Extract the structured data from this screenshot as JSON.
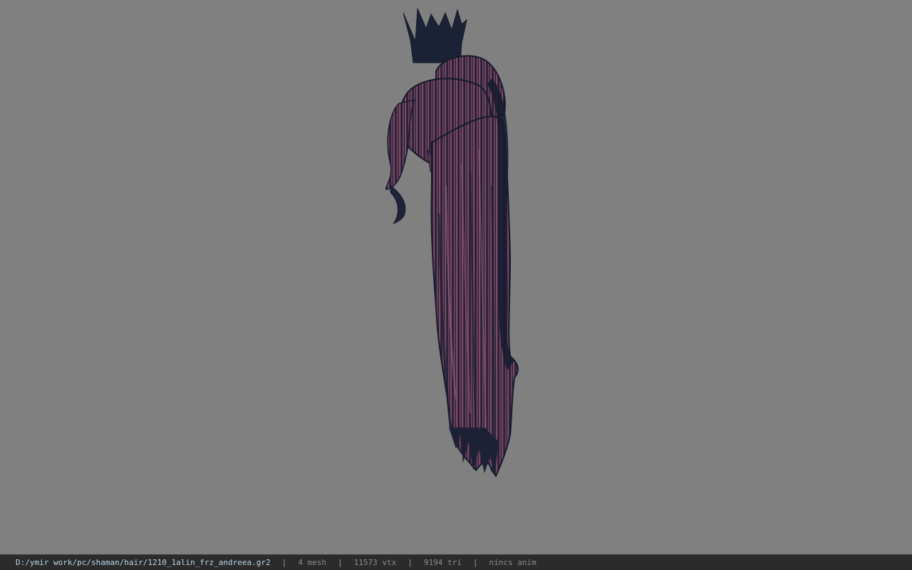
{
  "viewer": {
    "background_color": "#808080",
    "model": {
      "description_icon": "hair-mesh-icon",
      "dark_color": "#1a1f33",
      "strand_color": "#6e3f58",
      "highlight_color": "#9a6a82"
    }
  },
  "statusbar": {
    "file_path": "D:/ymir work/pc/shaman/hair/1210_1alin_frz_andreea.gr2",
    "separator": "|",
    "mesh_count": "4 mesh",
    "vertex_count": "11573 vtx",
    "triangle_count": "9194 tri",
    "anim_status": "nincs anim",
    "bg_color": "#2b2b2b",
    "path_color": "#b9d6ea"
  }
}
